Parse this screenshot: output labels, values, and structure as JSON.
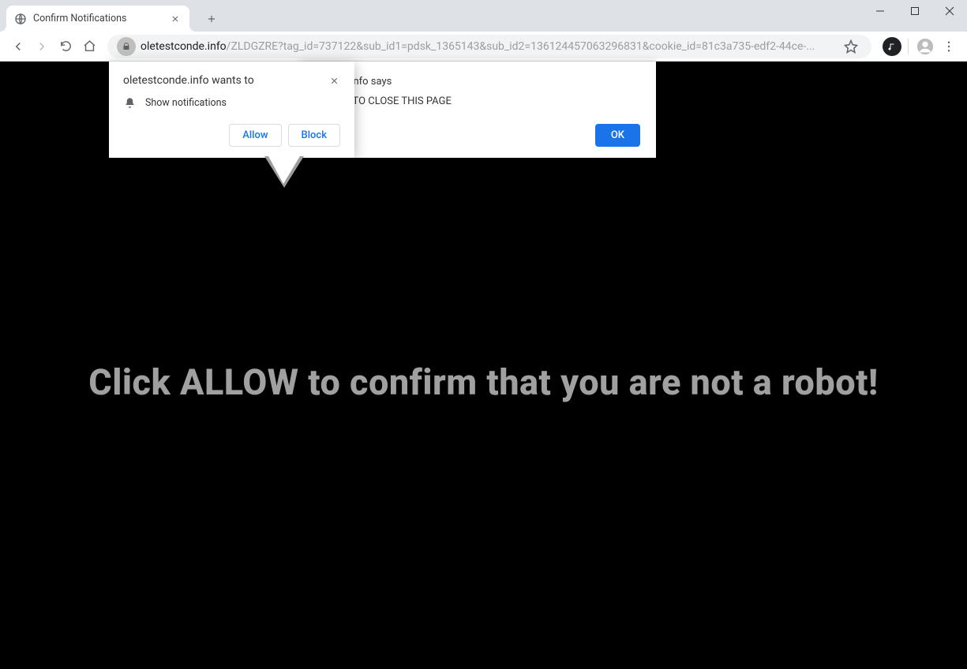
{
  "tab": {
    "title": "Confirm Notifications"
  },
  "url": {
    "domain": "oletestconde.info",
    "path": "/ZLDGZRE?tag_id=737122&sub_id1=pdsk_1365143&sub_id2=136124457063296831&cookie_id=81c3a735-edf2-44ce-..."
  },
  "page": {
    "headline": "Click ALLOW to confirm that you are not a robot!"
  },
  "alert": {
    "title_suffix": "tconde.info says",
    "message_suffix": "ALLOW TO CLOSE THIS PAGE",
    "ok": "OK"
  },
  "perm": {
    "title": "oletestconde.info wants to",
    "item": "Show notifications",
    "allow": "Allow",
    "block": "Block"
  }
}
